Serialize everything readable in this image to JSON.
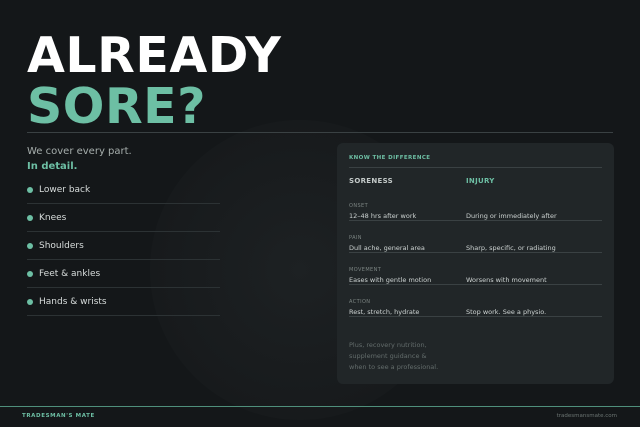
{
  "headline": {
    "line1": "ALREADY",
    "line2": "SORE?"
  },
  "tagline": {
    "line1": "We cover every part.",
    "line2": "In detail."
  },
  "parts": [
    {
      "label": "Lower back"
    },
    {
      "label": "Knees"
    },
    {
      "label": "Shoulders"
    },
    {
      "label": "Feet & ankles"
    },
    {
      "label": "Hands & wrists"
    }
  ],
  "card": {
    "heading": "KNOW THE DIFFERENCE",
    "col1": "SORENESS",
    "col2": "INJURY",
    "rows": [
      {
        "label": "ONSET",
        "soreness": "12–48 hrs after work",
        "injury": "During or immediately after"
      },
      {
        "label": "PAIN",
        "soreness": "Dull ache, general area",
        "injury": "Sharp, specific, or radiating"
      },
      {
        "label": "MOVEMENT",
        "soreness": "Eases with gentle motion",
        "injury": "Worsens with movement"
      },
      {
        "label": "ACTION",
        "soreness": "Rest, stretch, hydrate",
        "injury": "Stop work. See a physio."
      }
    ],
    "footnote": [
      "Plus, recovery nutrition,",
      "supplement guidance &",
      "when to see a professional."
    ]
  },
  "footer": {
    "brand": "TRADESMAN'S MATE",
    "site": "tradesmansmate.com"
  },
  "colors": {
    "accent": "#6dbfa4",
    "background": "#141719",
    "card": "#212628"
  }
}
